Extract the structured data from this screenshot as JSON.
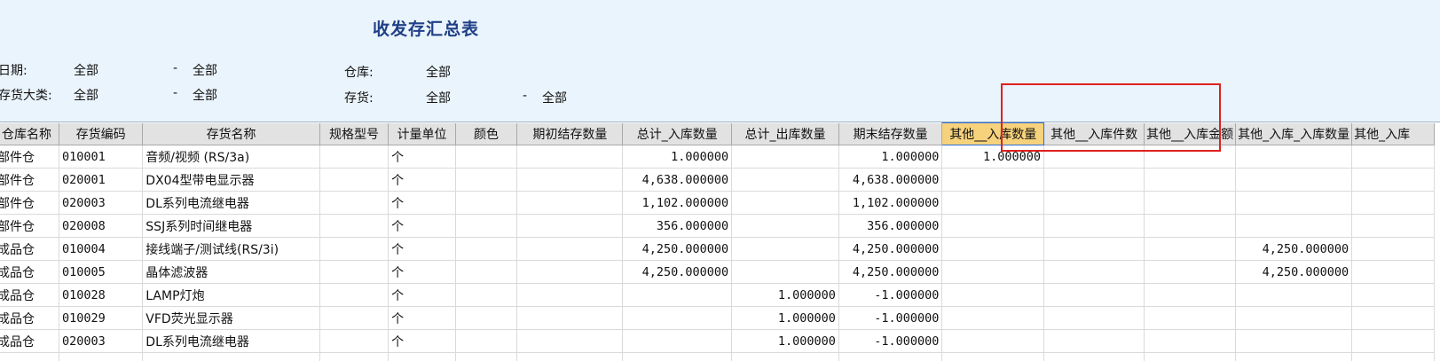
{
  "report": {
    "title": "收发存汇总表"
  },
  "filters": {
    "date_label": "日期:",
    "date_from": "全部",
    "date_sep": "-",
    "date_to": "全部",
    "warehouse_label": "仓库:",
    "warehouse_value": "全部",
    "category_label": "存货大类:",
    "category_from": "全部",
    "category_sep": "-",
    "category_to": "全部",
    "inventory_label": "存货:",
    "inventory_from": "全部",
    "inventory_sep": "-",
    "inventory_to": "全部"
  },
  "table": {
    "headers": [
      "仓库名称",
      "存货编码",
      "存货名称",
      "规格型号",
      "计量单位",
      "颜色",
      "期初结存数量",
      "总计_入库数量",
      "总计_出库数量",
      "期末结存数量",
      "其他__入库数量",
      "其他__入库件数",
      "其他__入库金额",
      "其他_入库_入库数量",
      "其他_入库"
    ],
    "active_header_index": 10,
    "rows": [
      [
        "部件仓",
        "010001",
        "音频/视频 (RS/3a)",
        "",
        "个",
        "",
        "",
        "1.000000",
        "",
        "1.000000",
        "1.000000",
        "",
        "",
        "",
        ""
      ],
      [
        "部件仓",
        "020001",
        "DX04型带电显示器",
        "",
        "个",
        "",
        "",
        "4,638.000000",
        "",
        "4,638.000000",
        "",
        "",
        "",
        "",
        ""
      ],
      [
        "部件仓",
        "020003",
        "DL系列电流继电器",
        "",
        "个",
        "",
        "",
        "1,102.000000",
        "",
        "1,102.000000",
        "",
        "",
        "",
        "",
        ""
      ],
      [
        "部件仓",
        "020008",
        "SSJ系列时间继电器",
        "",
        "个",
        "",
        "",
        "356.000000",
        "",
        "356.000000",
        "",
        "",
        "",
        "",
        ""
      ],
      [
        "成品仓",
        "010004",
        "接线端子/测试线(RS/3i)",
        "",
        "个",
        "",
        "",
        "4,250.000000",
        "",
        "4,250.000000",
        "",
        "",
        "",
        "4,250.000000",
        ""
      ],
      [
        "成品仓",
        "010005",
        "晶体滤波器",
        "",
        "个",
        "",
        "",
        "4,250.000000",
        "",
        "4,250.000000",
        "",
        "",
        "",
        "4,250.000000",
        ""
      ],
      [
        "成品仓",
        "010028",
        "LAMP灯炮",
        "",
        "个",
        "",
        "",
        "",
        "1.000000",
        "-1.000000",
        "",
        "",
        "",
        "",
        ""
      ],
      [
        "成品仓",
        "010029",
        "VFD荧光显示器",
        "",
        "个",
        "",
        "",
        "",
        "1.000000",
        "-1.000000",
        "",
        "",
        "",
        "",
        ""
      ],
      [
        "成品仓",
        "020003",
        "DL系列电流继电器",
        "",
        "个",
        "",
        "",
        "",
        "1.000000",
        "-1.000000",
        "",
        "",
        "",
        "",
        ""
      ],
      [
        "",
        "",
        "",
        "",
        "",
        "",
        "",
        "",
        "",
        "",
        "",
        "",
        "",
        "",
        ""
      ]
    ]
  }
}
